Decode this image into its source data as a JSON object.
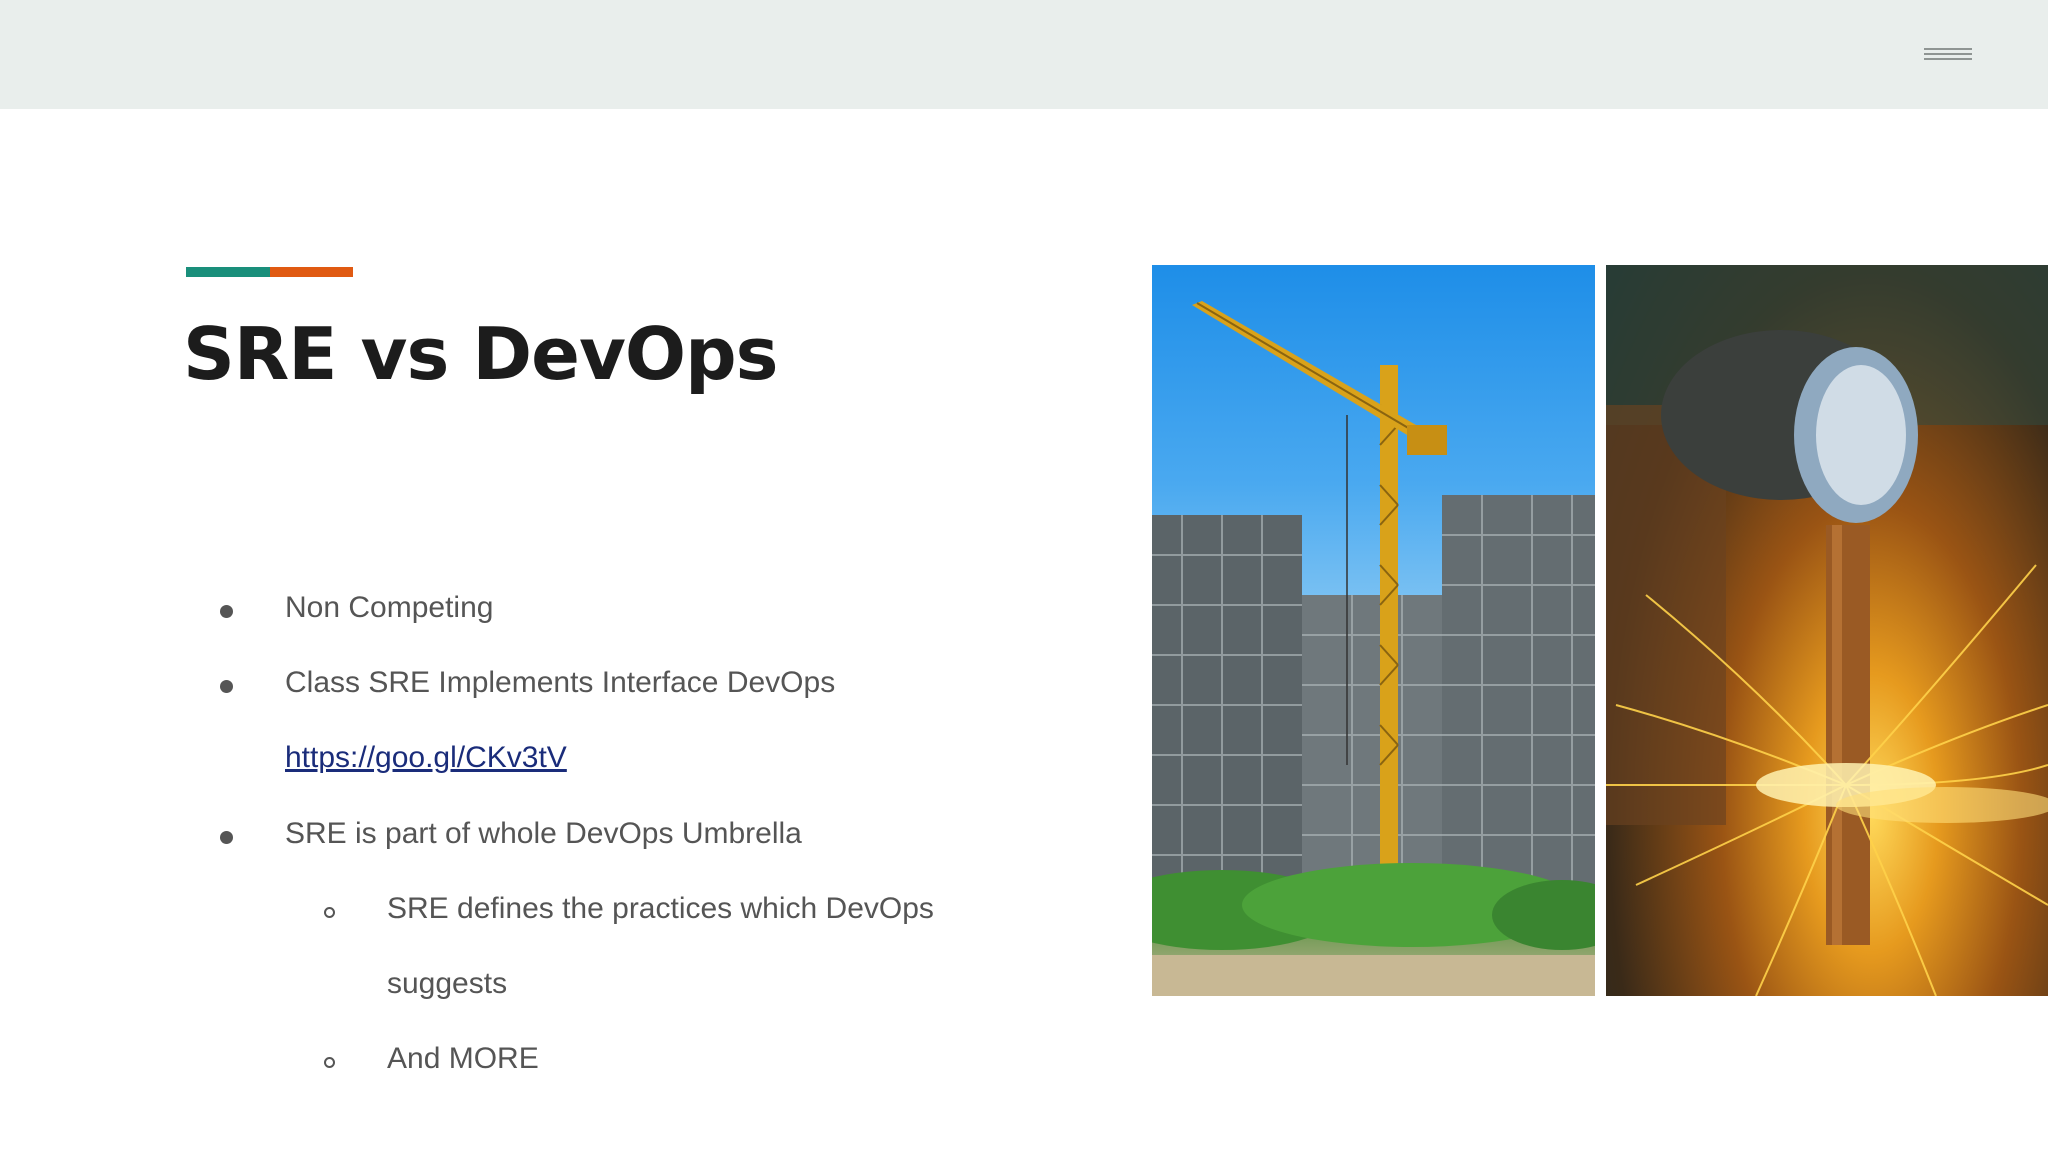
{
  "slide": {
    "title": "SRE vs DevOps",
    "bullets": [
      {
        "level": 1,
        "text": "Non Competing"
      },
      {
        "level": 1,
        "text": "Class SRE Implements Interface DevOps"
      },
      {
        "level": 1,
        "link": "https://goo.gl/CKv3tV"
      },
      {
        "level": 1,
        "text": "SRE is part of whole DevOps Umbrella"
      },
      {
        "level": 2,
        "text": "SRE defines the practices which DevOps"
      },
      {
        "level": 2,
        "text": "suggests"
      },
      {
        "level": 2,
        "text": "And MORE"
      }
    ]
  },
  "images": {
    "left": "construction-crane-photo",
    "right": "welding-sparks-photo"
  },
  "colors": {
    "topbar": "#e9eeec",
    "accent_teal": "#1a8f7b",
    "accent_orange": "#e05a12",
    "title": "#1c1c1c",
    "body_text": "#555555",
    "link": "#1a2c7a"
  },
  "icons": {
    "menu": "hamburger-menu-icon"
  }
}
